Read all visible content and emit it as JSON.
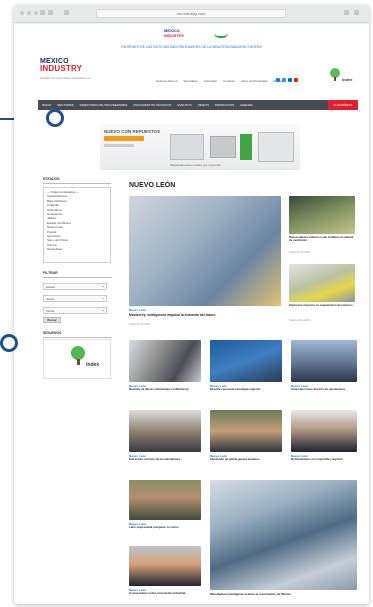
{
  "browser": {
    "url": "mx.industry.com"
  },
  "promo": {
    "logo_top": "MEXICO",
    "logo_bottom": "INDUSTRY",
    "text": "ENTÉRATE DE LAS NOTICIAS MÁS RELEVANTES DE LA INDUSTRIA MANUFACTURERA"
  },
  "header": {
    "logo_top": "MEXICO",
    "logo_bottom": "INDUSTRY",
    "tagline": "Noticias de la industria manufacturera",
    "links": [
      "Quiénes Somos",
      "Suscríbete",
      "Anúnciate",
      "Contacto",
      "Aviso de Privacidad",
      "Revista"
    ],
    "index_label": "index"
  },
  "nav": {
    "items": [
      "INICIO",
      "SECTORES",
      "DIRECTORIO DE PROVEEDORES",
      "DOCUMENTOS TÉCNICOS",
      "EVENTOS",
      "VIDEOS",
      "PRODUCTOS",
      "AGENDA"
    ],
    "cta": "SUSCRÍBETE"
  },
  "banner": {
    "title": "NUEVO CON REPUESTOS",
    "footer": "Maquinaria para moldeo por inyección"
  },
  "sidebar": {
    "heading": "ESTADOS",
    "list_title": "— Todos los Estados —",
    "states": [
      "Aguascalientes",
      "Baja California",
      "Coahuila",
      "Chihuahua",
      "Guanajuato",
      "Jalisco",
      "Estado de México",
      "Nuevo León",
      "Puebla",
      "Querétaro",
      "San Luis Potosí",
      "Sonora",
      "Tamaulipas"
    ],
    "filter_heading": "FILTRAR",
    "selects": [
      "Estado",
      "Sector",
      "Fecha",
      "Tipo"
    ],
    "button": "Buscar",
    "follow_heading": "SÍGUENOS",
    "sponsor_label": "index"
  },
  "section": {
    "title": "NUEVO LEÓN"
  },
  "articles": [
    {
      "category": "Nuevo León",
      "title": "Monterrey: Inteligencia impulsa la industria del futuro",
      "date": "Septiembre 2023"
    },
    {
      "category": "Nuevo León",
      "title": "Nueva planta en Nuevo León fortalece la cadena de suministro",
      "date": "Septiembre 2023"
    },
    {
      "category": "Nuevo León",
      "title": "Empresas invierten en capacitación de técnicos",
      "date": "Septiembre 2023"
    },
    {
      "category": "Nuevo León",
      "title": "Reunión de líderes industriales en Monterrey",
      "date": "Septiembre 2023"
    },
    {
      "category": "Nuevo León",
      "title": "Directivo presenta estrategia regional",
      "date": "Septiembre 2023"
    },
    {
      "category": "Nuevo León",
      "title": "Anuncian nuevo director de operaciones",
      "date": "Septiembre 2023"
    },
    {
      "category": "Nuevo León",
      "title": "Entrevista: el futuro de la manufactura",
      "date": "Septiembre 2023"
    },
    {
      "category": "Nuevo León",
      "title": "Expansión de planta genera empleos",
      "date": "Septiembre 2023"
    },
    {
      "category": "Nuevo León",
      "title": "Nombramiento en corporativo regional",
      "date": "Septiembre 2023"
    },
    {
      "category": "Nuevo León",
      "title": "Líder empresarial comparte su visión",
      "date": "Septiembre 2023"
    },
    {
      "category": "Nuevo León",
      "title": "Conversatorio sobre innovación industrial",
      "date": "Septiembre 2023"
    },
    {
      "category": "Nuevo León",
      "title": "Manufactura inteligente acelera el crecimiento de México",
      "date": "Septiembre 2023"
    }
  ]
}
